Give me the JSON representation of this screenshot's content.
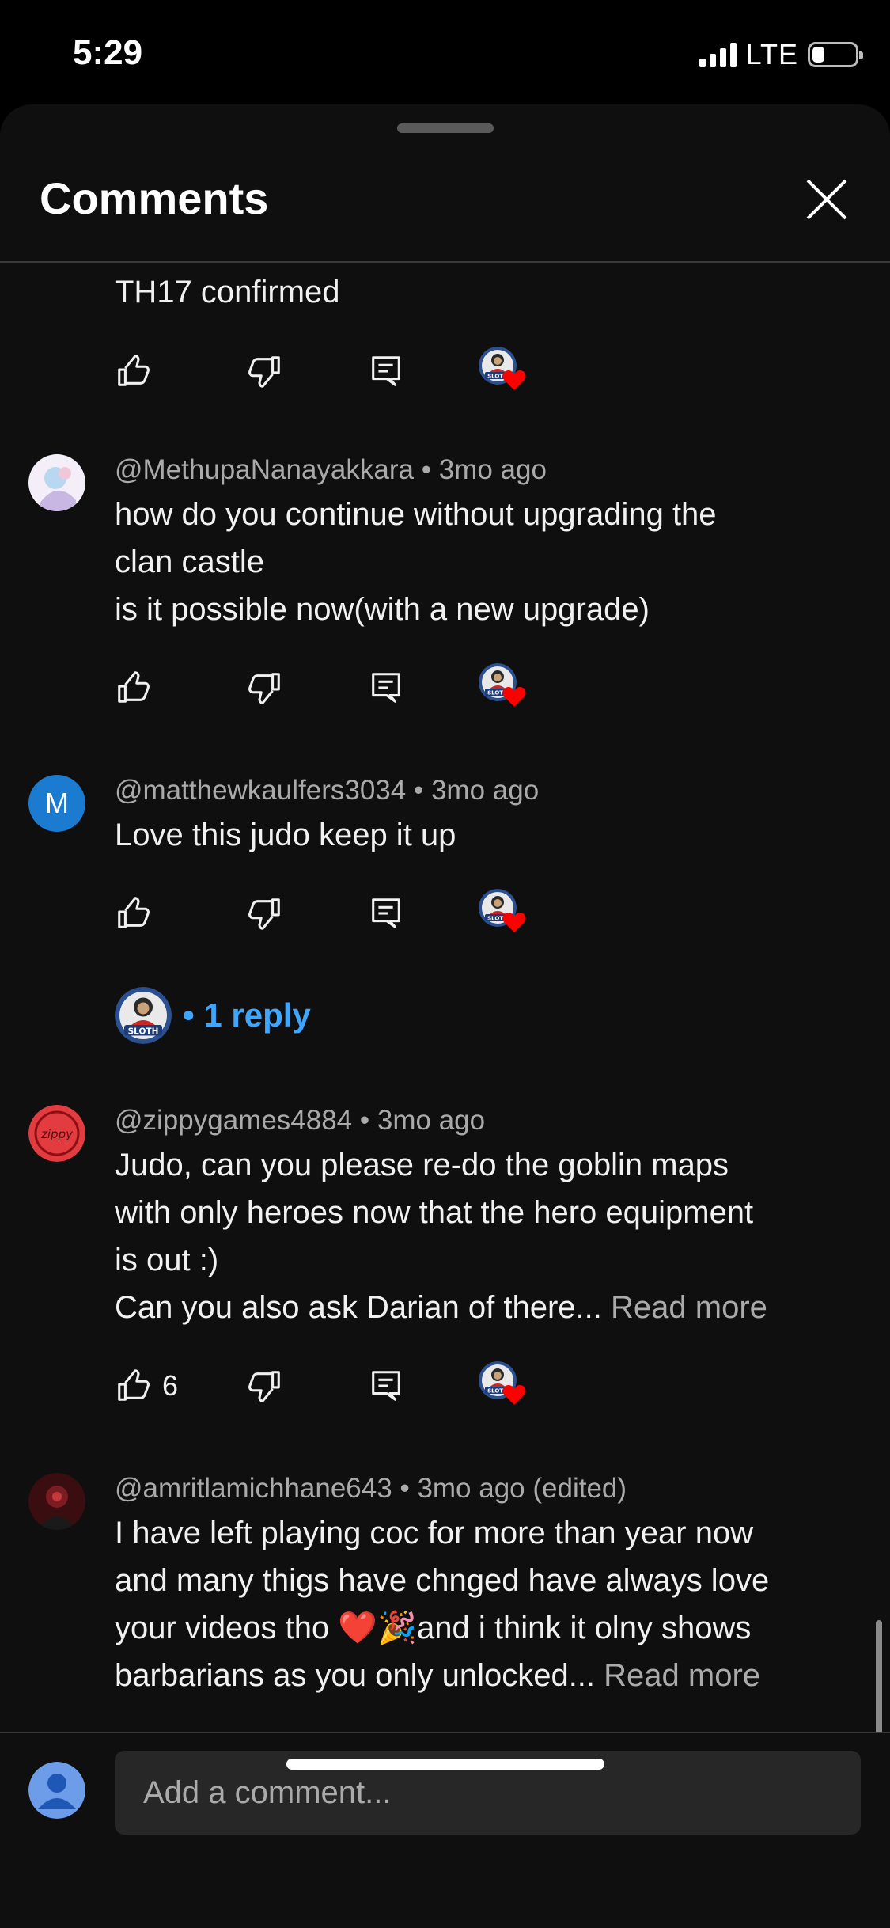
{
  "status_bar": {
    "time": "5:29",
    "network": "LTE"
  },
  "sheet": {
    "title": "Comments"
  },
  "comments": [
    {
      "author": "",
      "time": "",
      "text": "TH17 confirmed",
      "likes": ""
    },
    {
      "author": "@MethupaNanayakkara",
      "time": "3mo ago",
      "lines": [
        "how do you continue without upgrading the",
        "clan castle",
        "is it possible now(with a new upgrade)"
      ],
      "likes": ""
    },
    {
      "author": "@matthewkaulfers3034",
      "time": "3mo ago",
      "avatar_letter": "M",
      "text": "Love this judo keep it up",
      "likes": "",
      "replies": "1 reply"
    },
    {
      "author": "@zippygames4884",
      "time": "3mo ago",
      "lines": [
        "Judo, can you please re-do the goblin maps",
        "with only heroes now that the hero equipment",
        "is out :)"
      ],
      "last_line": "Can you also ask Darian of there...",
      "likes": "6"
    },
    {
      "author": "@amritlamichhane643",
      "time": "3mo ago (edited)",
      "lines": [
        "I have left playing coc for more than year now",
        "and many thigs have chnged have always love",
        "your videos tho ❤️🎉and i think it olny shows"
      ],
      "last_line": "barbarians as you only unlocked...",
      "likes": ""
    }
  ],
  "read_more": "Read more",
  "reply_separator": "•",
  "composer": {
    "placeholder": "Add a comment..."
  },
  "icons": {
    "like": "thumbs-up-icon",
    "dislike": "thumbs-down-icon",
    "reply": "reply-icon",
    "creator_heart": "creator-heart-icon",
    "close": "close-icon"
  },
  "colors": {
    "background": "#0f0f0f",
    "text": "#f1f1f1",
    "secondary": "#aaaaaa",
    "link": "#3ea6ff",
    "heart": "#ff0000"
  }
}
